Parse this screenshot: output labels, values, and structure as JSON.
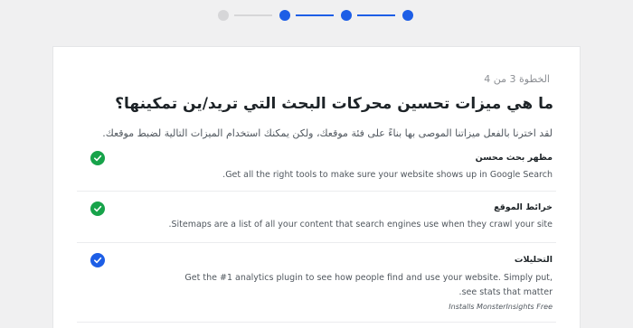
{
  "stepper": {
    "total_steps": 4,
    "completed_steps": 3,
    "active_color": "#1d5ee6",
    "pending_color": "#d6d6d8"
  },
  "card": {
    "step_label": "الخطوة 3 من 4",
    "title": "ما هي ميزات تحسين محركات البحث التي تريد/ين تمكينها؟",
    "subtitle": "لقد اخترنا بالفعل ميزاتنا الموصى بها بناءً على فئة موقعك، ولكن يمكنك استخدام الميزات التالية لضبط موقعك."
  },
  "features": [
    {
      "title": "مظهر بحث محسن",
      "description": "Get all the right tools to make sure your website shows up in Google Search.",
      "checked": true,
      "check_color": "#17a34a",
      "icon": "checkmark-icon"
    },
    {
      "title": "خرائط الموقع",
      "description": "Sitemaps are a list of all your content that search engines use when they crawl your site.",
      "checked": true,
      "check_color": "#17a34a",
      "icon": "checkmark-icon"
    },
    {
      "title": "التحليلات",
      "description": "Get the #1 analytics plugin to see how people find and use your website. Simply put, see stats that matter.",
      "note": "Installs MonsterInsights Free",
      "checked": true,
      "check_color": "#1d5ee6",
      "icon": "checkmark-icon"
    }
  ]
}
